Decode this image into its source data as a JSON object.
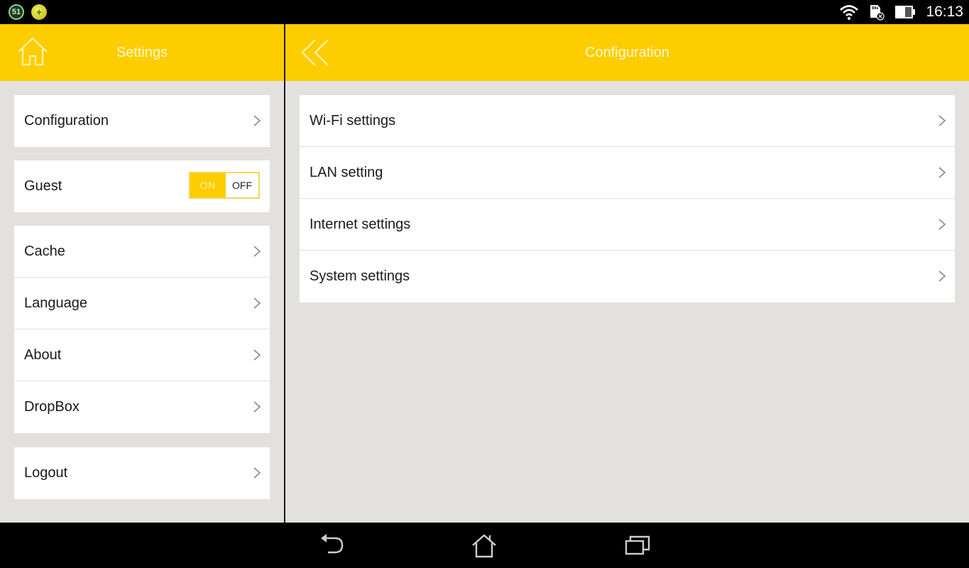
{
  "status_bar": {
    "notifications": [
      {
        "icon": "badge-51-icon",
        "text": "51"
      },
      {
        "icon": "game-ball-icon",
        "text": "+"
      }
    ],
    "icons": [
      "wifi-icon",
      "sd-card-error-icon",
      "battery-icon"
    ],
    "time": "16:13"
  },
  "left_pane": {
    "title": "Settings",
    "home_icon": "home-icon",
    "groups": [
      {
        "items": [
          {
            "label": "Configuration",
            "type": "link"
          }
        ]
      },
      {
        "items": [
          {
            "label": "Guest",
            "type": "toggle",
            "on_label": "ON",
            "off_label": "OFF",
            "state": "on"
          }
        ]
      },
      {
        "items": [
          {
            "label": "Cache",
            "type": "link"
          },
          {
            "label": "Language",
            "type": "link"
          },
          {
            "label": "About",
            "type": "link"
          },
          {
            "label": "DropBox",
            "type": "link"
          }
        ]
      },
      {
        "items": [
          {
            "label": "Logout",
            "type": "link"
          }
        ]
      }
    ]
  },
  "right_pane": {
    "title": "Configuration",
    "back_icon": "double-chevron-left-icon",
    "items": [
      {
        "label": "Wi-Fi settings"
      },
      {
        "label": "LAN setting"
      },
      {
        "label": "Internet settings"
      },
      {
        "label": "System settings"
      }
    ]
  },
  "nav_bar": {
    "buttons": [
      "back-icon",
      "home-icon",
      "recent-apps-icon"
    ]
  },
  "colors": {
    "accent": "#fecd00",
    "background": "#e2e1dd",
    "card": "#ffffff"
  }
}
